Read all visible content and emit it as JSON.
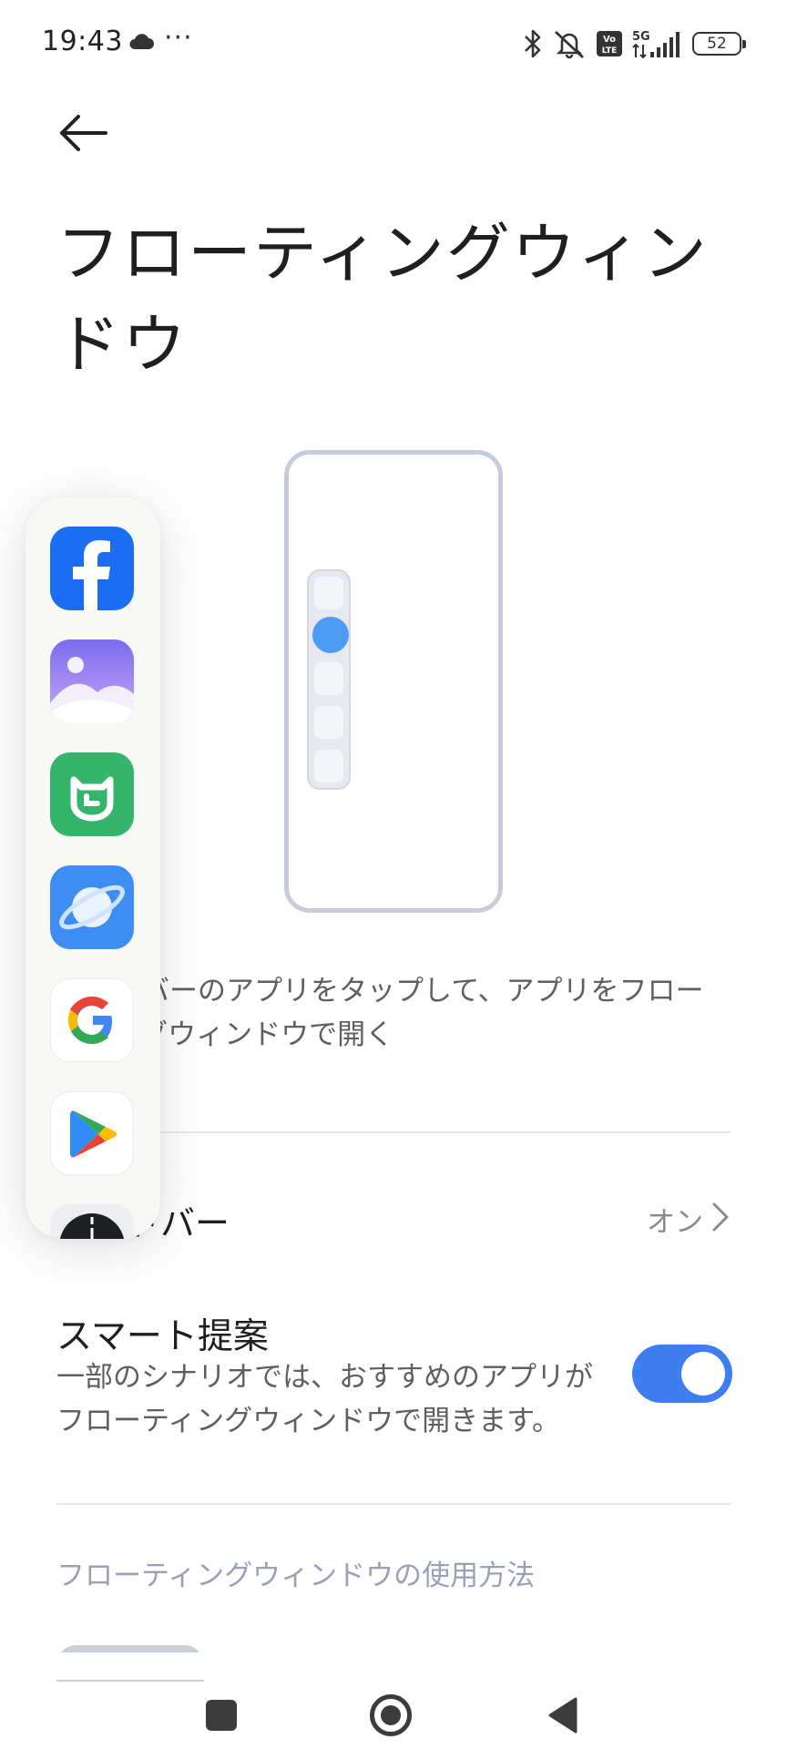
{
  "status_bar": {
    "time": "19:43",
    "dots": "···",
    "battery": "52",
    "icons": [
      "cloud-icon",
      "bluetooth-icon",
      "mute-icon",
      "volte-icon",
      "5g-signal-icon",
      "battery-icon"
    ]
  },
  "header": {
    "back_icon": "arrow-left-icon",
    "title": "フローティングウィンドウ"
  },
  "illustration": {
    "accent_color": "#4e9bf5",
    "frame_color": "#c7cbdc"
  },
  "description": "サイドバーのアプリをタップして、アプリをフローティングウィンドウで開く",
  "sidebar_setting": {
    "label": "サイドバー",
    "value": "オン"
  },
  "smart_suggestion": {
    "title": "スマート提案",
    "description": "一部のシナリオでは、おすすめのアプリがフローティングウィンドウで開きます。",
    "enabled": true,
    "accent_color": "#3f7ef1"
  },
  "usage_section": {
    "title": "フローティングウィンドウの使用方法"
  },
  "floating_sidebar": {
    "apps": [
      "facebook-icon",
      "gallery-icon",
      "mi-home-icon",
      "browser-icon",
      "google-icon",
      "play-store-icon",
      "clock-icon"
    ]
  },
  "nav_bar": {
    "buttons": [
      "recents-button",
      "home-button",
      "back-button"
    ]
  }
}
